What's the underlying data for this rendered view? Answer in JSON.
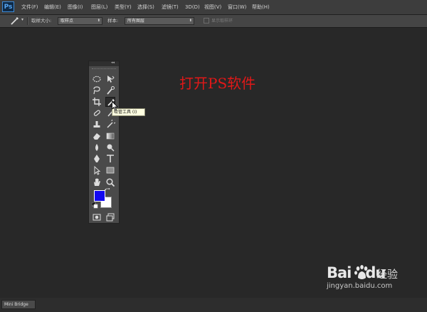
{
  "app": {
    "logo": "Ps"
  },
  "menu": [
    {
      "label": "文件(F)"
    },
    {
      "label": "编辑(E)"
    },
    {
      "label": "图像(I)"
    },
    {
      "label": "图层(L)"
    },
    {
      "label": "类型(Y)"
    },
    {
      "label": "选择(S)"
    },
    {
      "label": "滤镜(T)"
    },
    {
      "label": "3D(D)"
    },
    {
      "label": "视图(V)"
    },
    {
      "label": "窗口(W)"
    },
    {
      "label": "帮助(H)"
    }
  ],
  "options": {
    "sample_size_label": "取样大小:",
    "sample_size_value": "取样点",
    "sample_label": "样本:",
    "sample_value": "所有图层",
    "show_ring_label": "显示取样环"
  },
  "tools_panel": {
    "collapse_icon": "double-chevron-icon",
    "tooltip": "吸管工具 (I)"
  },
  "colors": {
    "foreground": "#1208f0",
    "background": "#ffffff",
    "caption": "#e01818"
  },
  "annotation": {
    "text": "打开PS软件"
  },
  "bottom_bar": {
    "mini_bridge": "Mini Bridge"
  },
  "watermark": {
    "logo_a": "Bai",
    "logo_b": "du",
    "jingyan": "经验",
    "url": "jingyan.baidu.com"
  }
}
